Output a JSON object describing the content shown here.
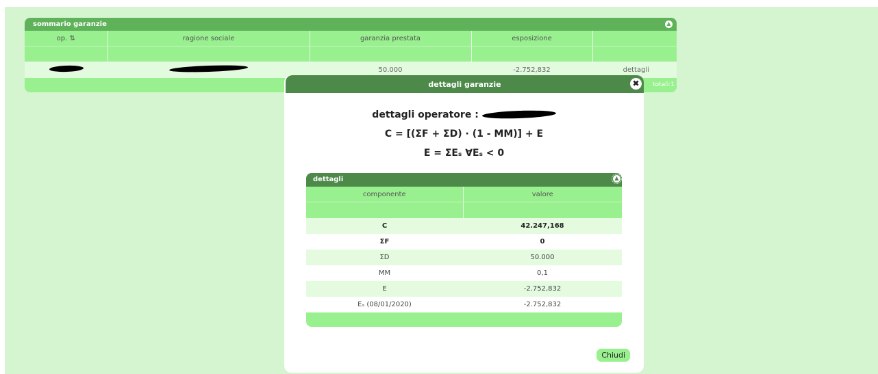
{
  "summary": {
    "title": "sommario garanzie",
    "columns": [
      "op. ⇅",
      "ragione sociale",
      "garanzia prestata",
      "esposizione",
      ""
    ],
    "row": {
      "op": "",
      "ragione_sociale": "",
      "garanzia_prestata": "50.000",
      "esposizione": "-2.752,832",
      "action": "dettagli"
    },
    "totals": "totali:1"
  },
  "modal": {
    "title": "dettagli garanzie",
    "operator_label": "dettagli operatore :",
    "formula_c": "C = [(ΣF + ΣD) · (1 - MM)] + E",
    "formula_e": "E = ΣEₛ ∀Eₛ < 0",
    "details": {
      "title": "dettagli",
      "columns": [
        "componente",
        "valore"
      ],
      "rows": [
        {
          "componente": "C",
          "valore": "42.247,168"
        },
        {
          "componente": "ΣF",
          "valore": "0"
        },
        {
          "componente": "ΣD",
          "valore": "50.000"
        },
        {
          "componente": "MM",
          "valore": "0,1"
        },
        {
          "componente": "E",
          "valore": "-2.752,832"
        },
        {
          "componente": "Eₛ (08/01/2020)",
          "valore": "-2.752,832"
        }
      ]
    },
    "close_label": "Chiudi"
  },
  "icons": {
    "collapse": "collapse-icon",
    "close": "close-icon",
    "sort": "sort-icon"
  }
}
